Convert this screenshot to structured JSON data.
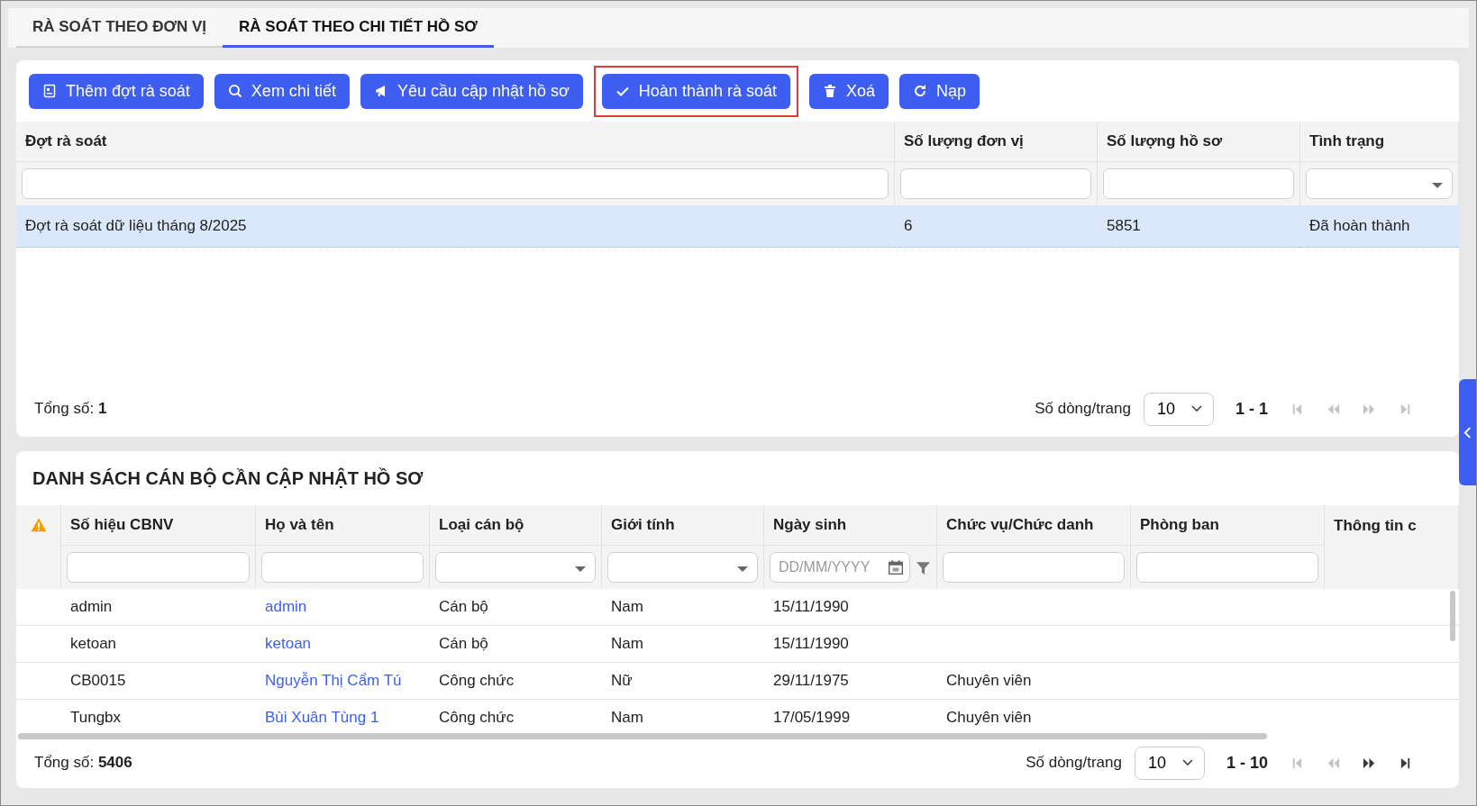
{
  "tabs": [
    {
      "label": "RÀ SOÁT THEO ĐƠN VỊ",
      "selected": false
    },
    {
      "label": "RÀ SOÁT THEO CHI TIẾT HỒ SƠ",
      "selected": true
    }
  ],
  "toolbar": [
    {
      "label": "Thêm đợt rà soát",
      "highlighted": false
    },
    {
      "label": "Xem chi tiết",
      "highlighted": false
    },
    {
      "label": "Yêu cầu cập nhật hồ sơ",
      "highlighted": false
    },
    {
      "label": "Hoàn thành rà soát",
      "highlighted": true
    },
    {
      "label": "Xoá",
      "highlighted": false
    },
    {
      "label": "Nạp",
      "highlighted": false
    }
  ],
  "review_table": {
    "columns": [
      {
        "label": "Đợt rà soát",
        "filter": {
          "kind": "text"
        }
      },
      {
        "label": "Số lượng đơn vị",
        "filter": {
          "kind": "text"
        }
      },
      {
        "label": "Số lượng hồ sơ",
        "filter": {
          "kind": "text"
        }
      },
      {
        "label": "Tình trạng",
        "filter": {
          "kind": "select"
        }
      }
    ],
    "rows": [
      {
        "cells": [
          "Đợt rà soát dữ liệu tháng 8/2025",
          "6",
          "5851",
          "Đã hoàn thành"
        ],
        "selected": true
      }
    ],
    "footer": {
      "total_label": "Tổng số:",
      "total": "1",
      "page_size_label": "Số dòng/trang",
      "page_size": "10",
      "range": "1 - 1",
      "nav": [
        {
          "kind": "first",
          "disabled": true
        },
        {
          "kind": "prev",
          "disabled": true
        },
        {
          "kind": "next",
          "disabled": true
        },
        {
          "kind": "last",
          "disabled": true
        }
      ]
    }
  },
  "staff_list": {
    "title": "DANH SÁCH CÁN BỘ CẦN CẬP NHẬT HỒ SƠ",
    "columns": [
      {
        "label": "Số hiệu CBNV",
        "filter": {
          "kind": "text"
        }
      },
      {
        "label": "Họ và tên",
        "filter": {
          "kind": "text"
        }
      },
      {
        "label": "Loại cán bộ",
        "filter": {
          "kind": "select"
        }
      },
      {
        "label": "Giới tính",
        "filter": {
          "kind": "select"
        }
      },
      {
        "label": "Ngày sinh",
        "filter": {
          "kind": "date",
          "placeholder": "DD/MM/YYYY"
        }
      },
      {
        "label": "Chức vụ/Chức danh",
        "filter": {
          "kind": "text"
        }
      },
      {
        "label": "Phòng ban",
        "filter": {
          "kind": "text"
        }
      },
      {
        "label": "Thông tin c"
      }
    ],
    "rows": [
      {
        "code": "admin",
        "name": "admin",
        "type": "Cán bộ",
        "gender": "Nam",
        "birth": "15/11/1990"
      },
      {
        "code": "ketoan",
        "name": "ketoan",
        "type": "Cán bộ",
        "gender": "Nam",
        "birth": "15/11/1990"
      },
      {
        "code": "CB0015",
        "name": "Nguyễn Thị Cẩm Tú",
        "type": "Công chức",
        "gender": "Nữ",
        "birth": "29/11/1975",
        "position": "Chuyên viên"
      },
      {
        "code": "Tungbx",
        "name": "Bùi Xuân Tùng 1",
        "type": "Công chức",
        "gender": "Nam",
        "birth": "17/05/1999",
        "position": "Chuyên viên"
      }
    ],
    "footer": {
      "total_label": "Tổng số:",
      "total": "5406",
      "page_size_label": "Số dòng/trang",
      "page_size": "10",
      "range": "1 - 10",
      "nav": [
        {
          "kind": "first",
          "disabled": true
        },
        {
          "kind": "prev",
          "disabled": true
        },
        {
          "kind": "next",
          "disabled": false
        },
        {
          "kind": "last",
          "disabled": false
        }
      ]
    }
  }
}
